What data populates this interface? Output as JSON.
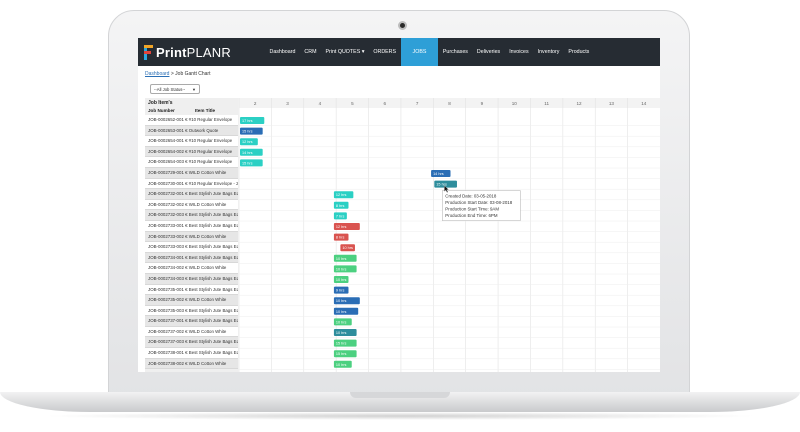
{
  "app": {
    "logo_main": "Print",
    "logo_tail": "PLANR",
    "nav": [
      {
        "label": "Dashboard",
        "active": false
      },
      {
        "label": "CRM",
        "active": false
      },
      {
        "label": "Print QUOTES ▾",
        "active": false
      },
      {
        "label": "ORDERS",
        "active": false
      },
      {
        "label": "JOBS",
        "active": true
      },
      {
        "label": "Purchases",
        "active": false
      },
      {
        "label": "Deliveries",
        "active": false
      },
      {
        "label": "Invoices",
        "active": false
      },
      {
        "label": "Inventory",
        "active": false
      },
      {
        "label": "Products",
        "active": false
      }
    ],
    "accent_color": "#2e9fd7"
  },
  "breadcrumb": {
    "link": "Dashboard",
    "separator": " > ",
    "current": "Job Gantt Chart"
  },
  "filter": {
    "value": "--All Job Status--"
  },
  "panel": {
    "title": "Job Item's",
    "col1": "Job Number",
    "col2": "Item Title",
    "rows": [
      "JOB-0002652-001 € #10 Regular Envelope",
      "JOB-0002653-001 € Outwork Quote",
      "JOB-0002654-001 € #10 Regular Envelope",
      "JOB-0002654-002 € #10 Regular Envelope",
      "JOB-0002654-003 € #10 Regular Envelope",
      "JOB-0002729-001 € WILD Cotton White",
      "JOB-0002730-001 € #10 Regular Envelope - 2",
      "JOB-0002732-001 € Best Stylish Jute Bags Edit",
      "JOB-0002732-002 € WILD Cotton White",
      "JOB-0002732-003 € Best Stylish Jute Bags Edit",
      "JOB-0002733-001 € Best Stylish Jute Bags Edit",
      "JOB-0002733-002 € WILD Cotton White",
      "JOB-0002733-003 € Best Stylish Jute Bags Edit",
      "JOB-0002734-001 € Best Stylish Jute Bags Edit",
      "JOB-0002734-002 € WILD Cotton White",
      "JOB-0002734-003 € Best Stylish Jute Bags Edit",
      "JOB-0002735-001 € Best Stylish Jute Bags Edit",
      "JOB-0002735-002 € WILD Cotton White",
      "JOB-0002735-003 € Best Stylish Jute Bags Edit",
      "JOB-0002737-001 € Best Stylish Jute Bags Edit",
      "JOB-0002737-002 € WILD Cotton White",
      "JOB-0002737-003 € Best Stylish Jute Bags Edit",
      "JOB-0002738-001 € Best Stylish Jute Bags Edit",
      "JOB-0002738-002 € WILD Cotton White"
    ]
  },
  "chart_data": {
    "type": "gantt",
    "days": [
      "2",
      "3",
      "4",
      "5",
      "6",
      "7",
      "8",
      "9",
      "10",
      "11",
      "12",
      "13",
      "14"
    ],
    "bars": [
      {
        "row": 0,
        "start": 2,
        "span": 0.75,
        "label": "17 hrs",
        "color": "#2bd0c4"
      },
      {
        "row": 1,
        "start": 2,
        "span": 0.7,
        "label": "15 hrs",
        "color": "#2a6db5"
      },
      {
        "row": 2,
        "start": 2,
        "span": 0.55,
        "label": "12 hrs",
        "color": "#2bd0c4"
      },
      {
        "row": 3,
        "start": 2,
        "span": 0.7,
        "label": "14 hrs",
        "color": "#2bd0c4"
      },
      {
        "row": 4,
        "start": 2,
        "span": 0.7,
        "label": "15 hrs",
        "color": "#2bd0c4"
      },
      {
        "row": 5,
        "start": 7.9,
        "span": 0.6,
        "label": "14 hrs",
        "color": "#2a6db5"
      },
      {
        "row": 6,
        "start": 8.0,
        "span": 0.7,
        "label": "15 hrs",
        "color": "#2e8d9c"
      },
      {
        "row": 7,
        "start": 4.9,
        "span": 0.6,
        "label": "12 hrs",
        "color": "#2bd0c4"
      },
      {
        "row": 8,
        "start": 4.9,
        "span": 0.45,
        "label": "8 hrs",
        "color": "#2bd0c4"
      },
      {
        "row": 9,
        "start": 4.9,
        "span": 0.4,
        "label": "7 hrs",
        "color": "#2bd0c4"
      },
      {
        "row": 10,
        "start": 4.9,
        "span": 0.8,
        "label": "12 hrs",
        "color": "#d9534f"
      },
      {
        "row": 11,
        "start": 4.9,
        "span": 0.45,
        "label": "8 hrs",
        "color": "#d9534f"
      },
      {
        "row": 12,
        "start": 5.1,
        "span": 0.45,
        "label": "10 hrs",
        "color": "#d9534f"
      },
      {
        "row": 13,
        "start": 4.9,
        "span": 0.7,
        "label": "10 hrs",
        "color": "#4cd080"
      },
      {
        "row": 14,
        "start": 4.9,
        "span": 0.7,
        "label": "10 hrs",
        "color": "#4cd080"
      },
      {
        "row": 15,
        "start": 4.9,
        "span": 0.45,
        "label": "10 hrs",
        "color": "#4cd080"
      },
      {
        "row": 16,
        "start": 4.9,
        "span": 0.45,
        "label": "9 hrs",
        "color": "#2a6db5"
      },
      {
        "row": 17,
        "start": 4.9,
        "span": 0.8,
        "label": "10 hrs",
        "color": "#2a6db5"
      },
      {
        "row": 18,
        "start": 4.9,
        "span": 0.75,
        "label": "10 hrs",
        "color": "#2a6db5"
      },
      {
        "row": 19,
        "start": 4.9,
        "span": 0.55,
        "label": "10 hrs",
        "color": "#4cd080"
      },
      {
        "row": 20,
        "start": 4.9,
        "span": 0.7,
        "label": "10 hrs",
        "color": "#2e8d9c"
      },
      {
        "row": 21,
        "start": 4.9,
        "span": 0.7,
        "label": "15 hrs",
        "color": "#4cd080"
      },
      {
        "row": 22,
        "start": 4.9,
        "span": 0.7,
        "label": "15 hrs",
        "color": "#4cd080"
      },
      {
        "row": 23,
        "start": 4.9,
        "span": 0.55,
        "label": "10 hrs",
        "color": "#4cd080"
      }
    ],
    "tooltip": {
      "row": 6,
      "lines": [
        "Created Date: 03-05-2018",
        "Production Start Date: 03-08-2018",
        "Production Start Time: 9AM",
        "Production End Time: 6PM"
      ]
    }
  }
}
